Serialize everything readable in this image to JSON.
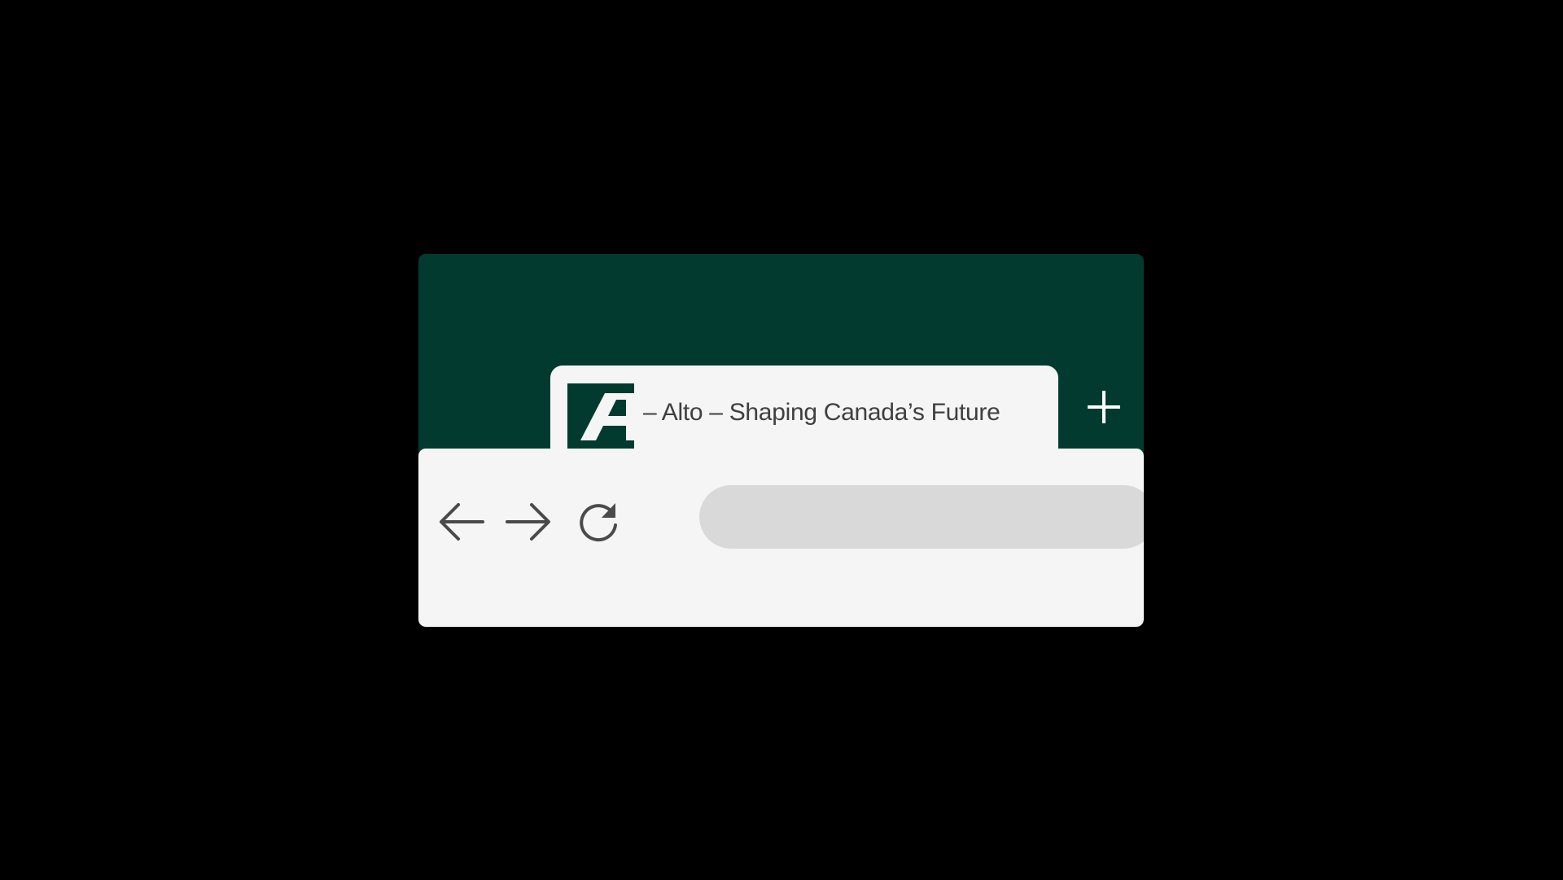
{
  "colors": {
    "background": "#000000",
    "brand_green": "#033a30",
    "tab_background": "#f4f5f4",
    "toolbar_background": "#f4f5f4",
    "address_bar_fill": "#d9d9d9",
    "icon_stroke": "#4a4a4a",
    "text": "#3f3f3f",
    "new_tab_icon": "#ffffff"
  },
  "tab": {
    "title": "– Alto – Shaping Canada’s Future",
    "favicon": "alto-logo-icon",
    "favicon_letter": "A"
  },
  "tab_strip": {
    "new_tab_icon": "plus-icon"
  },
  "toolbar": {
    "back_icon": "arrow-left-icon",
    "forward_icon": "arrow-right-icon",
    "reload_icon": "reload-icon",
    "address_value": "",
    "address_placeholder": ""
  }
}
